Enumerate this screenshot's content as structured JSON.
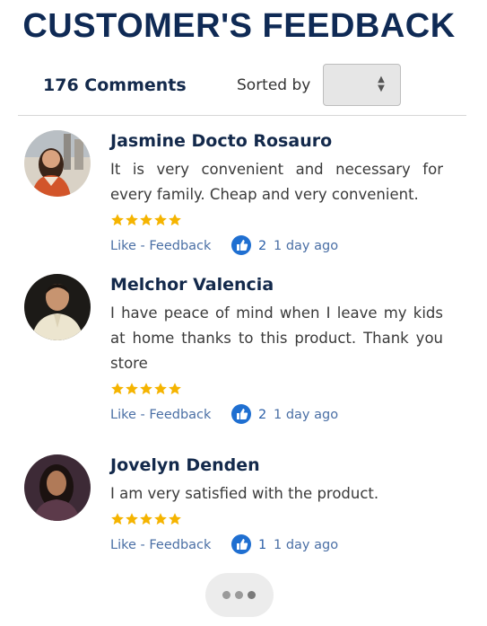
{
  "header": {
    "title": "CUSTOMER'S FEEDBACK"
  },
  "toolbar": {
    "count": "176 Comments",
    "sorted_label": "Sorted by",
    "sort_value": ""
  },
  "comments": [
    {
      "name": "Jasmine Docto Rosauro",
      "text": "It is very convenient and necessary for every family. Cheap and very convenient.",
      "stars": 5,
      "like_link": "Like - Feedback",
      "likes": "2",
      "time": "1 day ago"
    },
    {
      "name": "Melchor Valencia",
      "text": "I have peace of mind when I leave my kids at home thanks to this product. Thank you store",
      "stars": 5,
      "like_link": "Like - Feedback",
      "likes": "2",
      "time": "1 day ago"
    },
    {
      "name": "Jovelyn Denden",
      "text": "I am very satisfied with the product.",
      "stars": 5,
      "like_link": "Like - Feedback",
      "likes": "1",
      "time": "1 day ago"
    }
  ],
  "colors": {
    "title": "#0f2a55",
    "star": "#f5b400",
    "link": "#4a6fa5",
    "thumb": "#1f6fd1"
  },
  "icons": {
    "sort": "up-down-arrows-icon",
    "like": "thumbs-up-icon",
    "star": "star-icon",
    "more": "ellipsis-icon"
  }
}
